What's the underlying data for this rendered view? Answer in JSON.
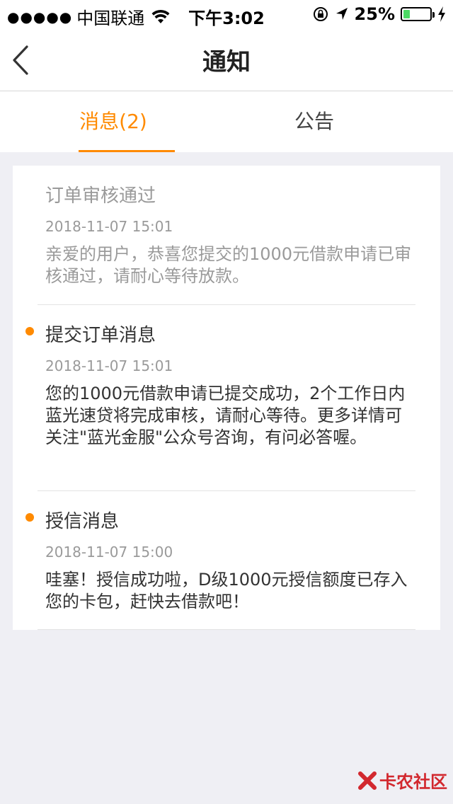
{
  "status_bar": {
    "signal": "●●●●●",
    "carrier": "中国联通",
    "time": "下午3:02",
    "battery_pct": "25%",
    "battery_level": 0.25
  },
  "nav": {
    "title": "通知"
  },
  "tabs": [
    {
      "label": "消息(2)",
      "active": true
    },
    {
      "label": "公告",
      "active": false
    }
  ],
  "messages": [
    {
      "title": "订单审核通过",
      "time": "2018-11-07 15:01",
      "body": "亲爱的用户，恭喜您提交的1000元借款申请已审核通过，请耐心等待放款。",
      "read": true
    },
    {
      "title": "提交订单消息",
      "time": "2018-11-07 15:01",
      "body": "您的1000元借款申请已提交成功，2个工作日内蓝光速贷将完成审核，请耐心等待。更多详情可关注\"蓝光金服\"公众号咨询，有问必答喔。",
      "read": false
    },
    {
      "title": "授信消息",
      "time": "2018-11-07 15:00",
      "body": "哇塞！授信成功啦，D级1000元授信额度已存入您的卡包，赶快去借款吧！",
      "read": false
    }
  ],
  "watermark": {
    "text": "卡农社区"
  },
  "colors": {
    "accent": "#ff8a00",
    "background": "#efeff4",
    "read_text": "#9a9a9a",
    "unread_text": "#333333"
  }
}
